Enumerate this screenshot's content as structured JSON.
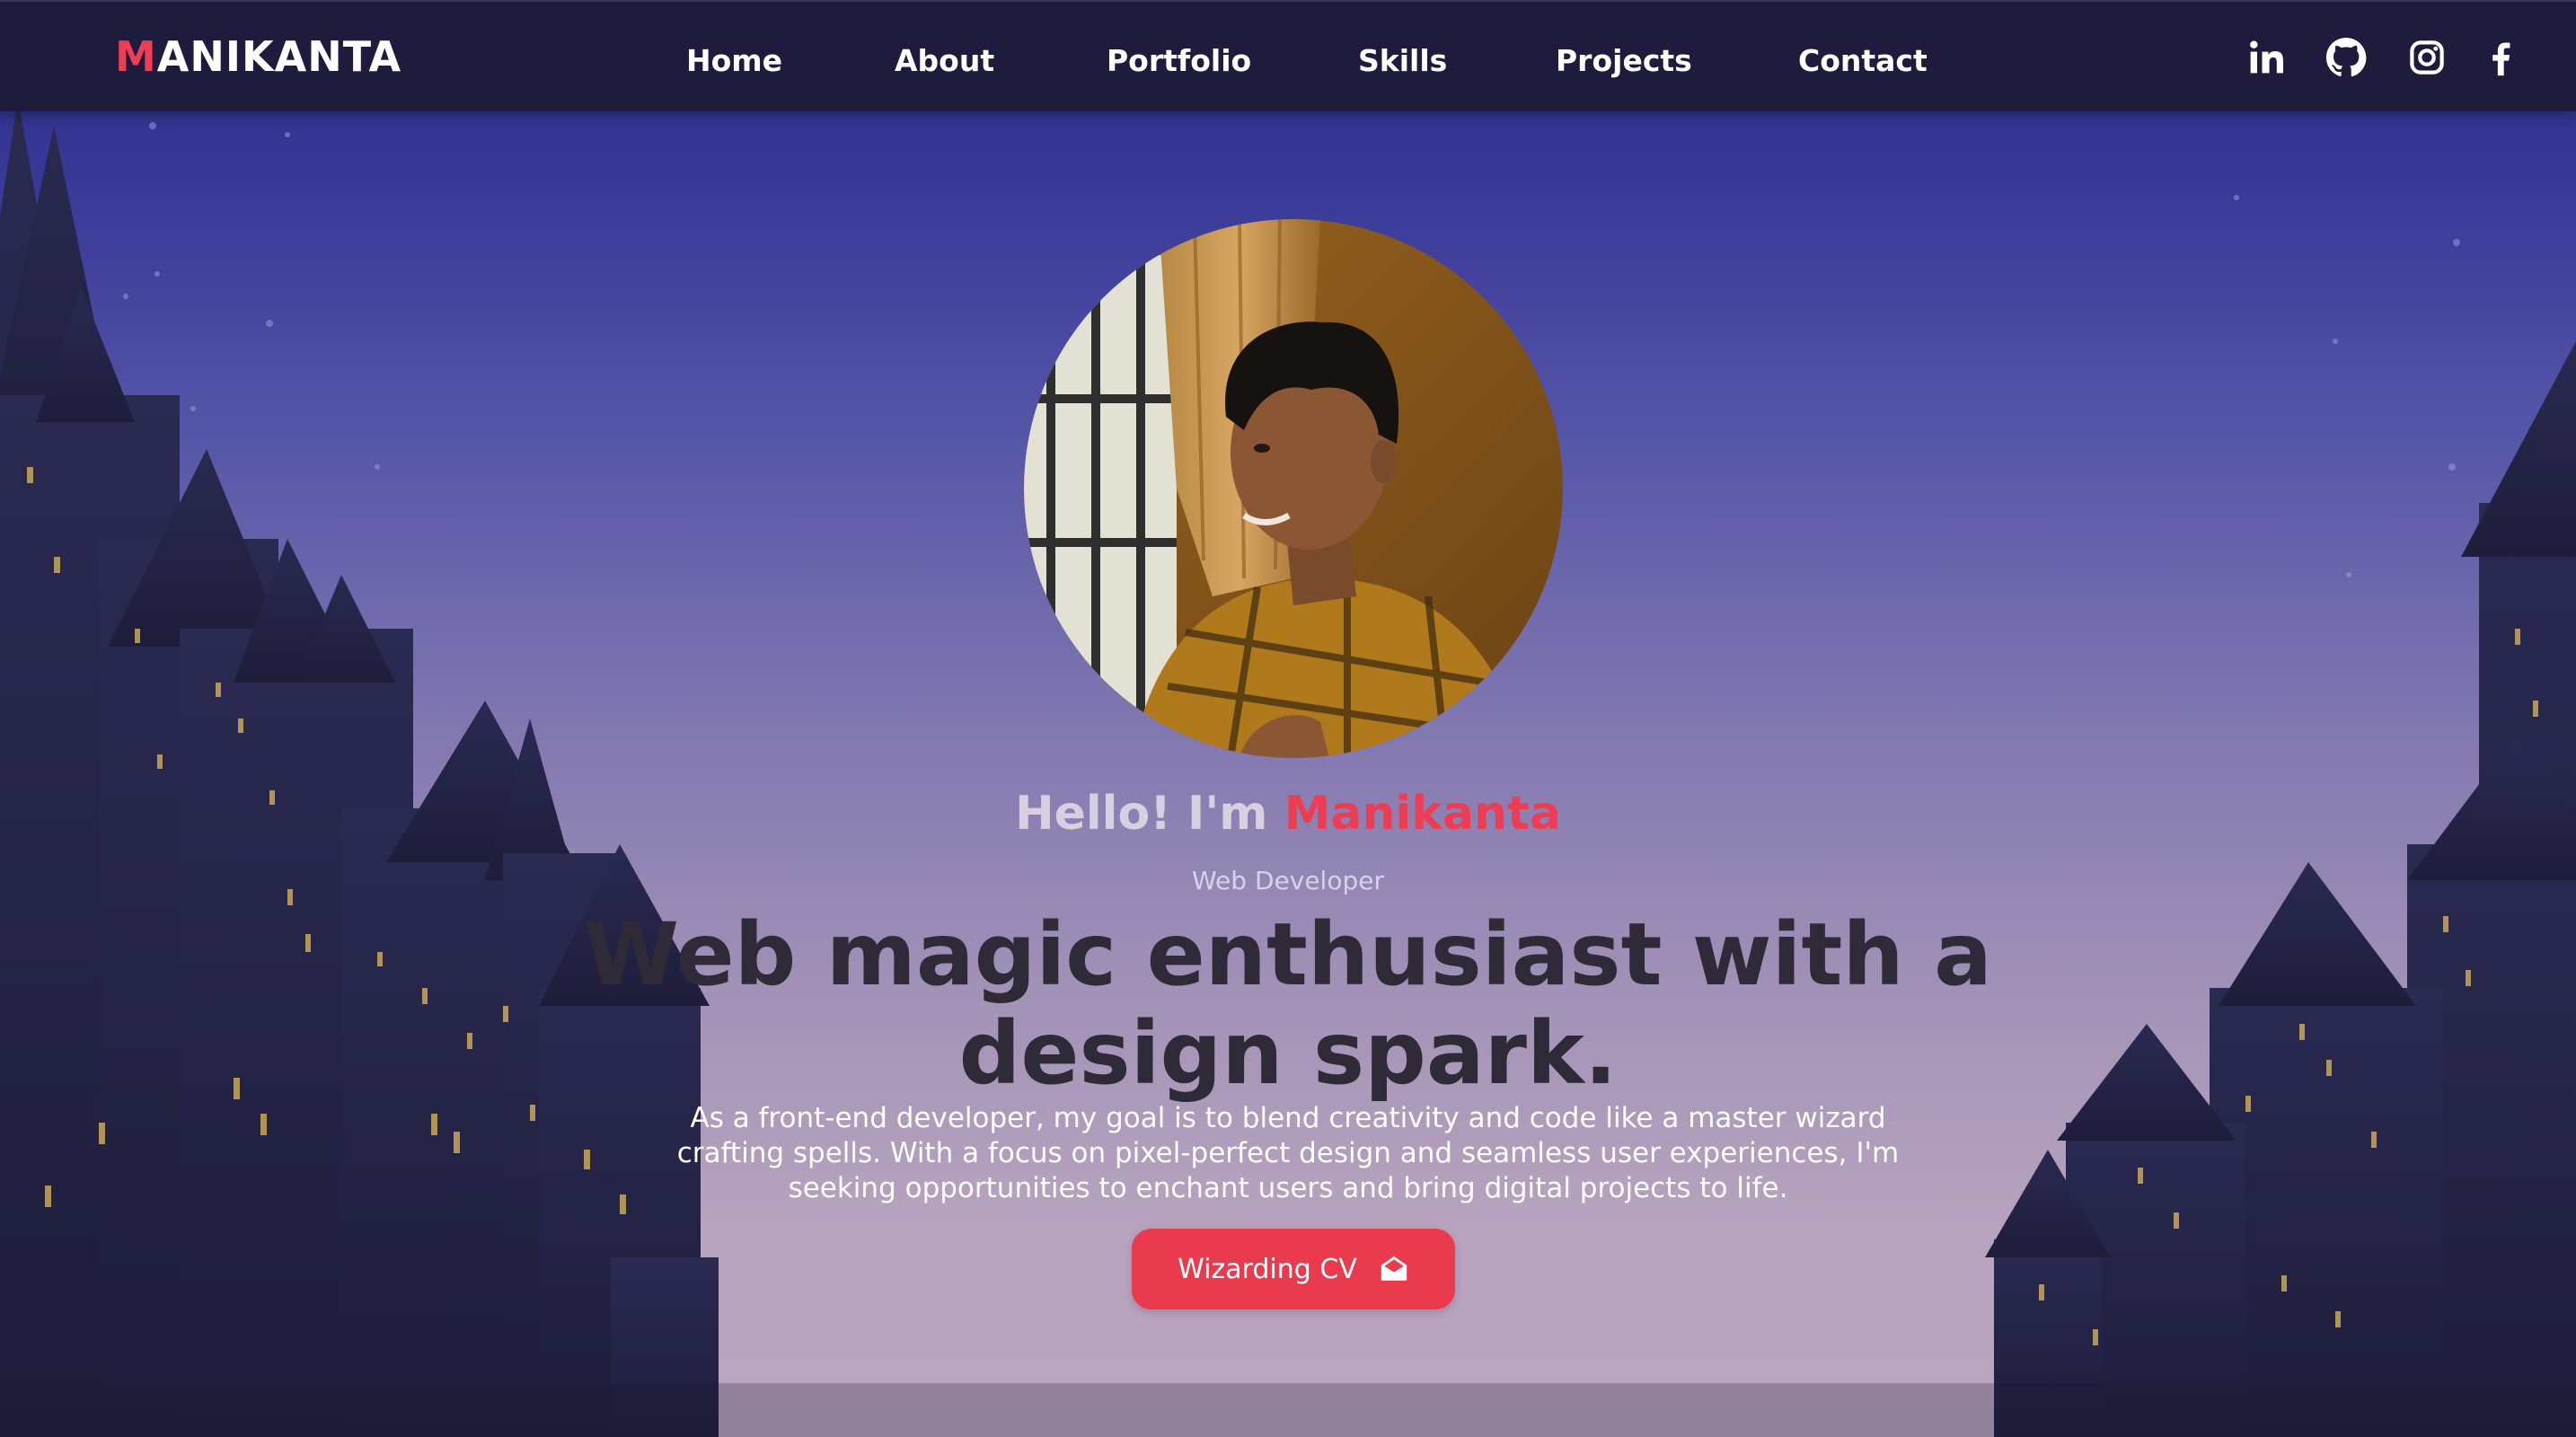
{
  "brand": {
    "first_letter": "M",
    "rest": "ANIKANTA"
  },
  "nav": {
    "items": [
      {
        "label": "Home"
      },
      {
        "label": "About"
      },
      {
        "label": "Portfolio"
      },
      {
        "label": "Skills"
      },
      {
        "label": "Projects"
      },
      {
        "label": "Contact"
      }
    ]
  },
  "socials": [
    {
      "icon": "linkedin-icon"
    },
    {
      "icon": "github-icon"
    },
    {
      "icon": "instagram-icon"
    },
    {
      "icon": "facebook-icon"
    }
  ],
  "hero": {
    "greeting": "Hello! I'm ",
    "name": "Manikanta",
    "role": "Web Developer",
    "headline": "Web magic enthusiast with a design spark.",
    "description": "As a front-end developer, my goal is to blend creativity and code like a master wizard crafting spells. With a focus on pixel-perfect design and seamless user experiences, I'm seeking opportunities to enchant users and bring digital projects to life.",
    "cv_button": "Wizarding CV",
    "cv_icon": "envelope-open-icon"
  },
  "colors": {
    "accent": "#ea3a4e",
    "nav_bg": "#1e1b3d",
    "headline": "#2f2a38"
  }
}
